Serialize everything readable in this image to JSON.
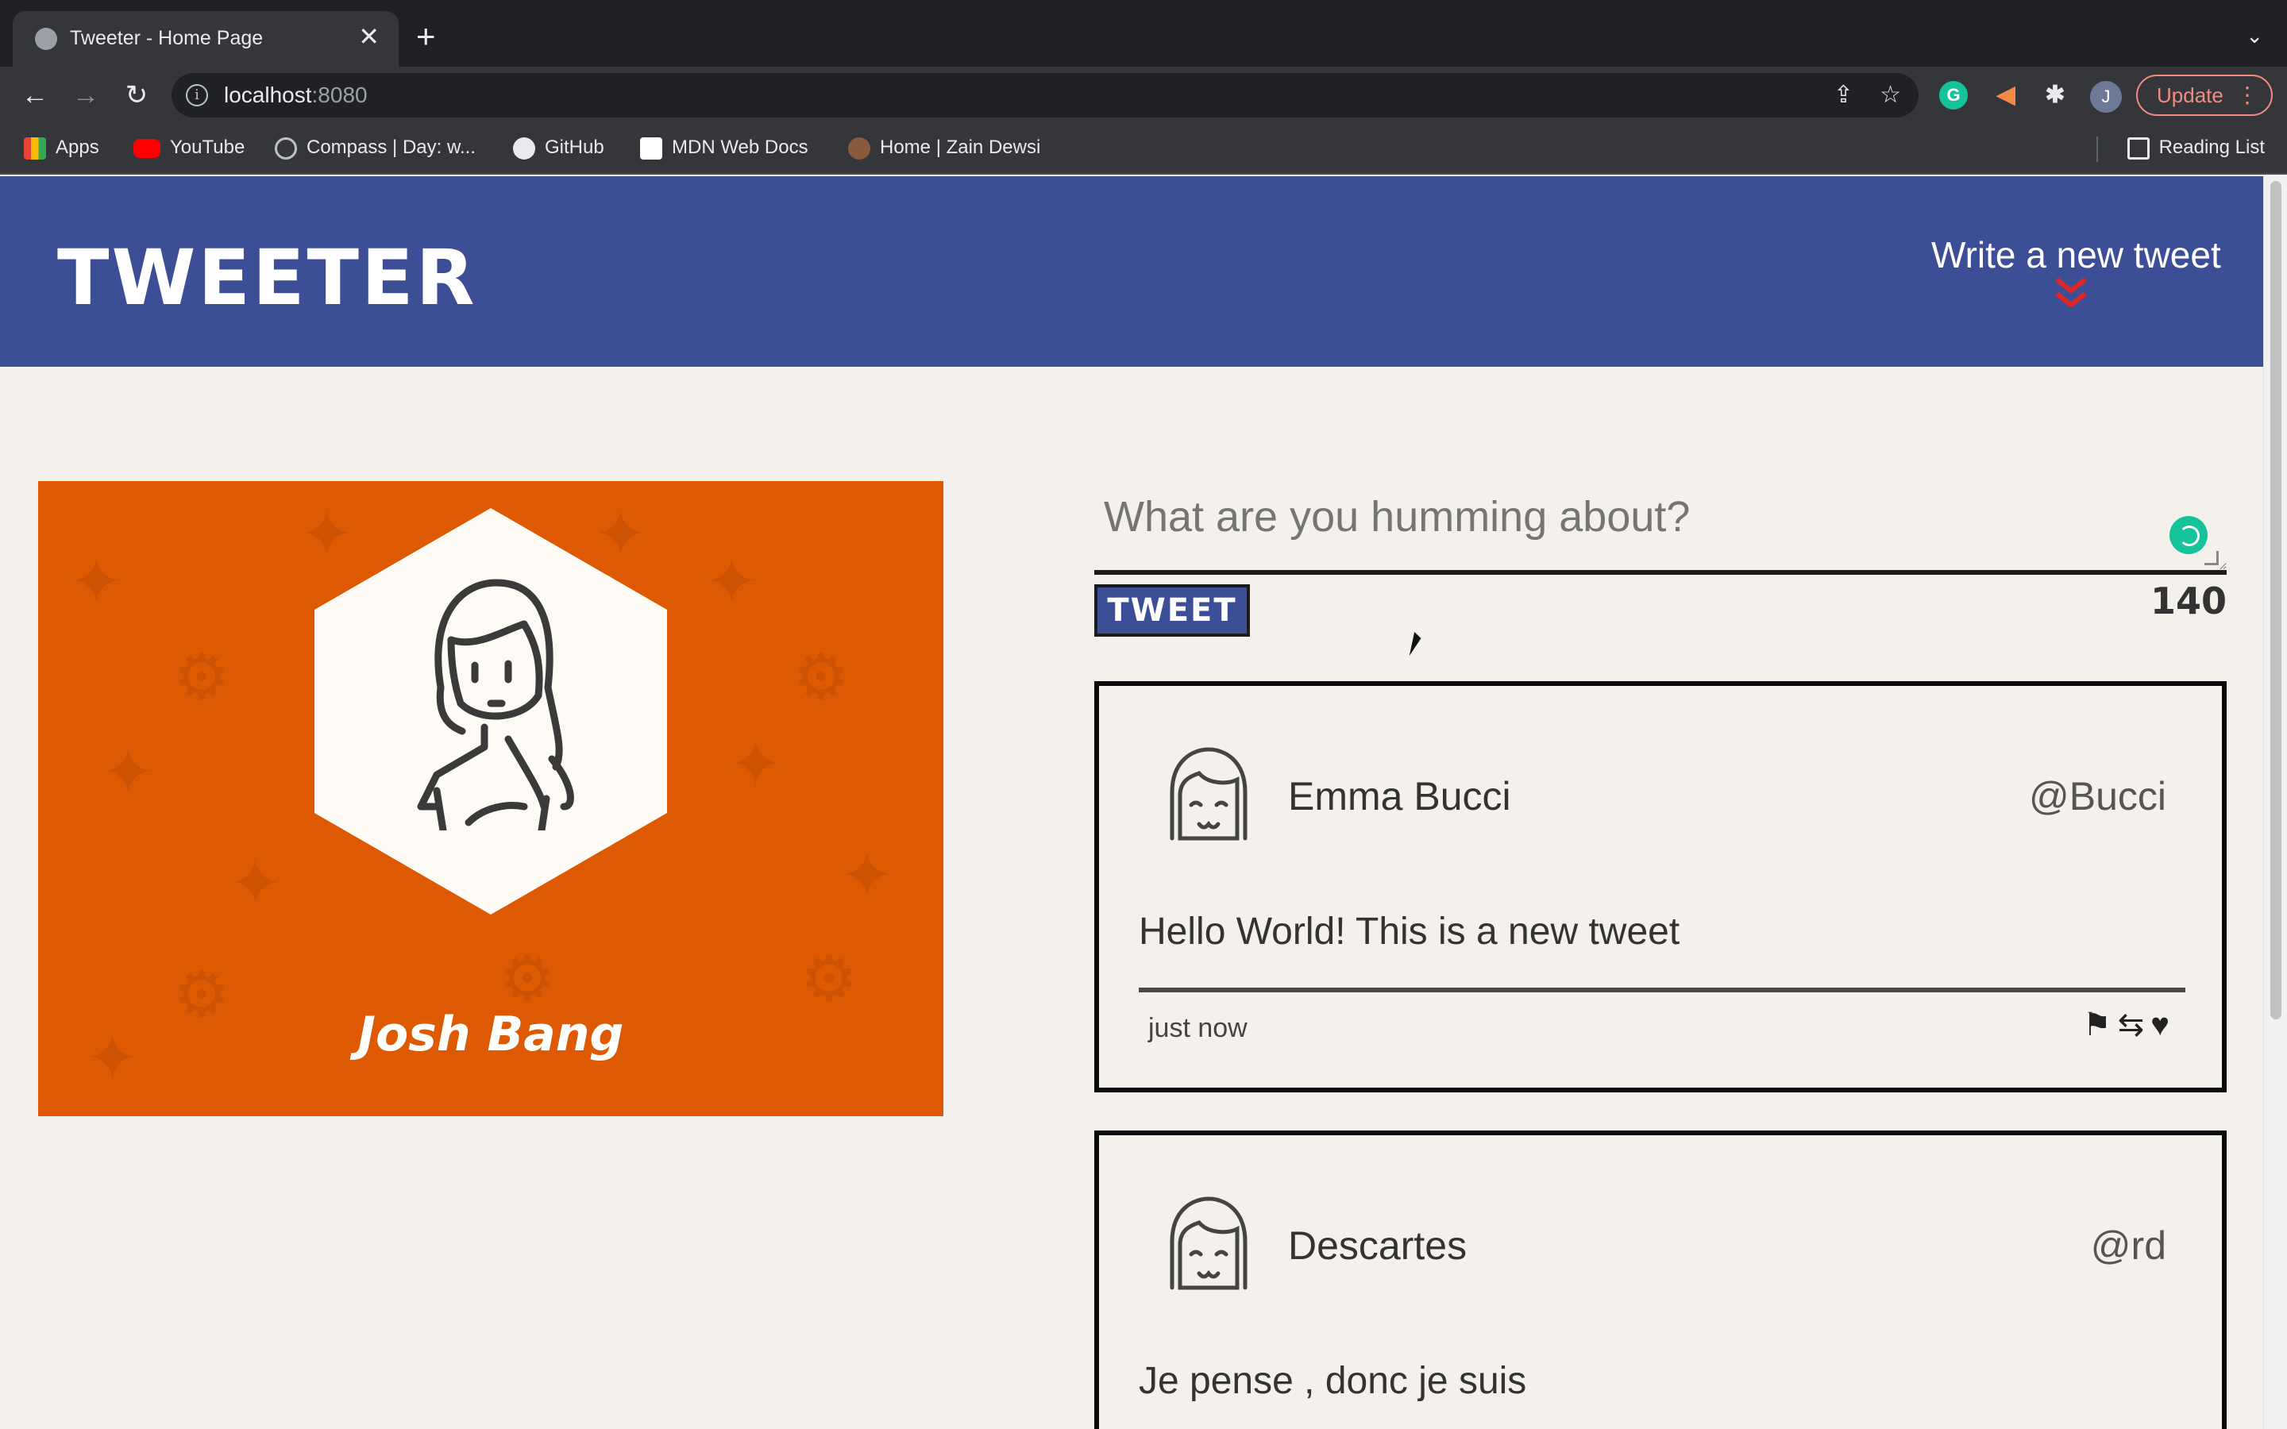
{
  "browser": {
    "tab_title": "Tweeter - Home Page",
    "tab_close": "✕",
    "new_tab": "+",
    "tab_search": "⌄",
    "url_host": "localhost",
    "url_port": ":8080",
    "info_glyph": "i",
    "back": "←",
    "forward": "→",
    "reload": "↻",
    "share": "⇪",
    "star": "☆",
    "profile_initial": "J",
    "update_label": "Update",
    "menu_dots": "⋮",
    "bookmarks": [
      "Apps",
      "YouTube",
      "Compass | Day: w...",
      "GitHub",
      "MDN Web Docs",
      "Home | Zain Dewsi"
    ],
    "reading_list": "Reading List"
  },
  "header": {
    "brand": "TWEETER",
    "compose_prefix": "Write",
    "compose_rest": " a new tweet",
    "chevron": "⌄⌄"
  },
  "profile": {
    "name": "Josh Bang"
  },
  "composer": {
    "placeholder": "What are you humming about?",
    "tweet_button": "TWEET",
    "counter": "140"
  },
  "tweets": [
    {
      "name": "Emma Bucci",
      "handle": "@Bucci",
      "body": "Hello World! This is a new tweet",
      "time": "just now",
      "actions": "⚑⇆♥"
    },
    {
      "name": "Descartes",
      "handle": "@rd",
      "body": "Je pense , donc je suis"
    }
  ]
}
